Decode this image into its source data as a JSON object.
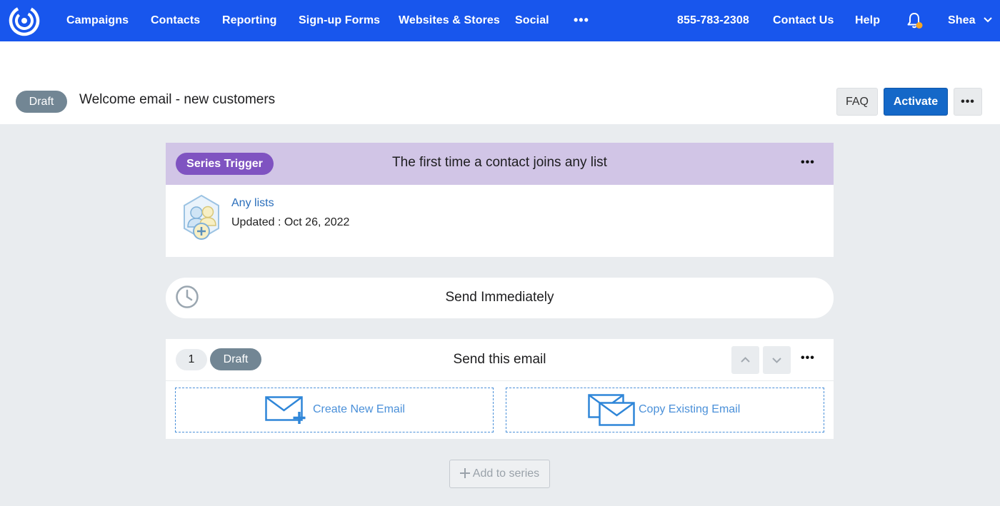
{
  "nav": {
    "items": [
      "Campaigns",
      "Contacts",
      "Reporting",
      "Sign-up Forms",
      "Websites & Stores",
      "Social"
    ],
    "more": "•••",
    "phone": "855-783-2308",
    "contact_us": "Contact Us",
    "help": "Help",
    "user": "Shea",
    "brand_color": "#1856ED",
    "notification_dot_color": "#F5A623"
  },
  "header": {
    "status": "Draft",
    "title": "Welcome email - new customers",
    "faq_label": "FAQ",
    "activate_label": "Activate",
    "more_label": "•••"
  },
  "trigger": {
    "badge": "Series Trigger",
    "title": "The first time a contact joins any list",
    "more_label": "•••",
    "list_link": "Any lists",
    "updated": "Updated : Oct 26, 2022"
  },
  "delay": {
    "label": "Send Immediately"
  },
  "email_step": {
    "number": "1",
    "status": "Draft",
    "title": "Send this email",
    "more_label": "•••",
    "create_label": "Create New Email",
    "copy_label": "Copy Existing Email"
  },
  "footer": {
    "add_label": "Add to series"
  }
}
